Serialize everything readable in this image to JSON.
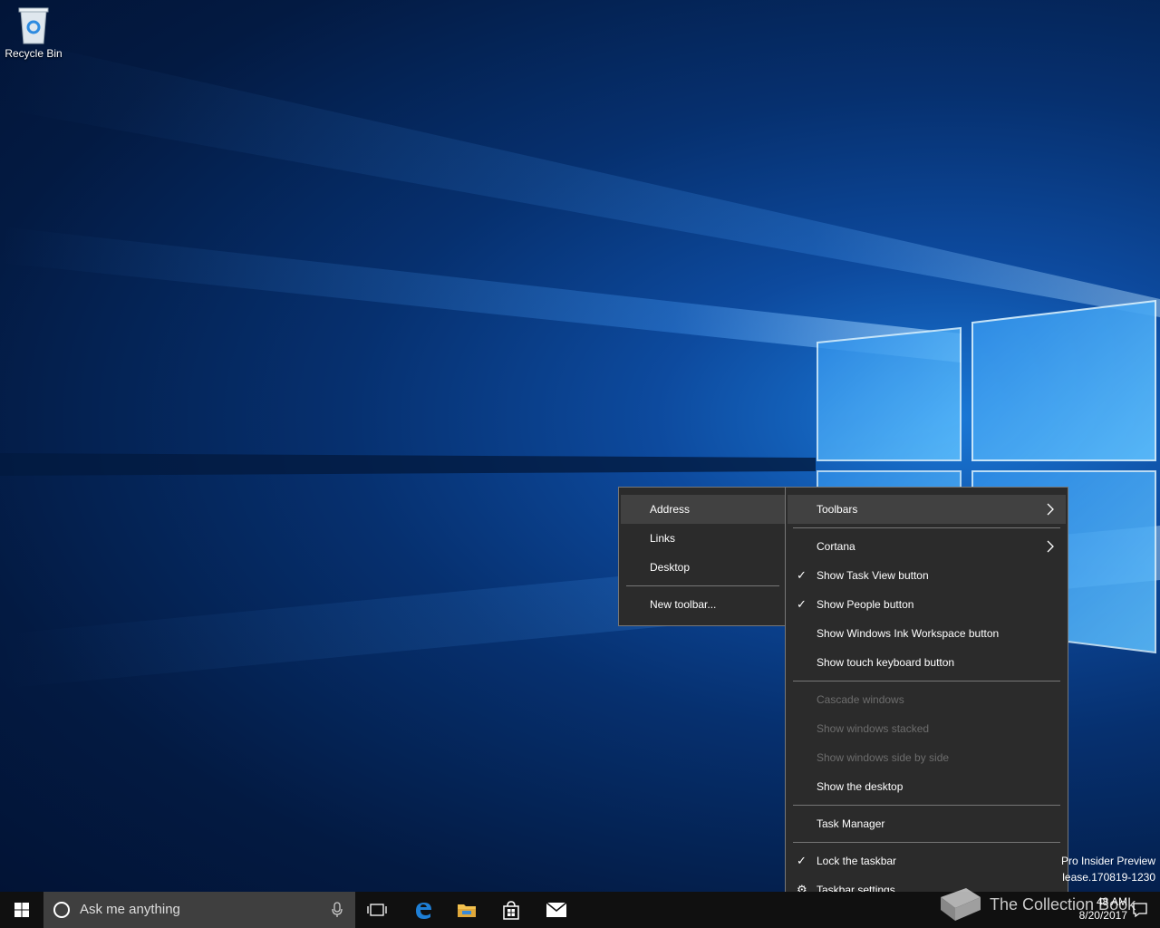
{
  "desktop": {
    "recycle_bin_label": "Recycle Bin"
  },
  "toolbars_submenu": {
    "items": [
      {
        "label": "Address",
        "highlighted": true
      },
      {
        "label": "Links"
      },
      {
        "label": "Desktop"
      },
      {
        "label": "New toolbar..."
      }
    ]
  },
  "taskbar_menu": {
    "toolbars": "Toolbars",
    "cortana": "Cortana",
    "show_task_view": "Show Task View button",
    "show_people": "Show People button",
    "show_ink": "Show Windows Ink Workspace button",
    "show_touch_keyboard": "Show touch keyboard button",
    "cascade": "Cascade windows",
    "stacked": "Show windows stacked",
    "side_by_side": "Show windows side by side",
    "show_desktop": "Show the desktop",
    "task_manager": "Task Manager",
    "lock_taskbar": "Lock the taskbar",
    "taskbar_settings": "Taskbar settings",
    "checked": [
      "Show Task View button",
      "Show People button",
      "Lock the taskbar"
    ]
  },
  "taskbar": {
    "search_placeholder": "Ask me anything",
    "watermark_line1": "Pro Insider Preview",
    "watermark_line2": "lease.170819-1230",
    "time": "48 AM",
    "date": "8/20/2017",
    "brand_text": "The Collection Book"
  },
  "colors": {
    "menu_bg": "#2b2b2b",
    "menu_highlight": "#414141",
    "menu_border": "#767676",
    "taskbar_bg": "#101010",
    "search_bg": "#3f3f3f",
    "edge_blue": "#1e7fd6",
    "folder_yellow": "#f2c14e"
  }
}
